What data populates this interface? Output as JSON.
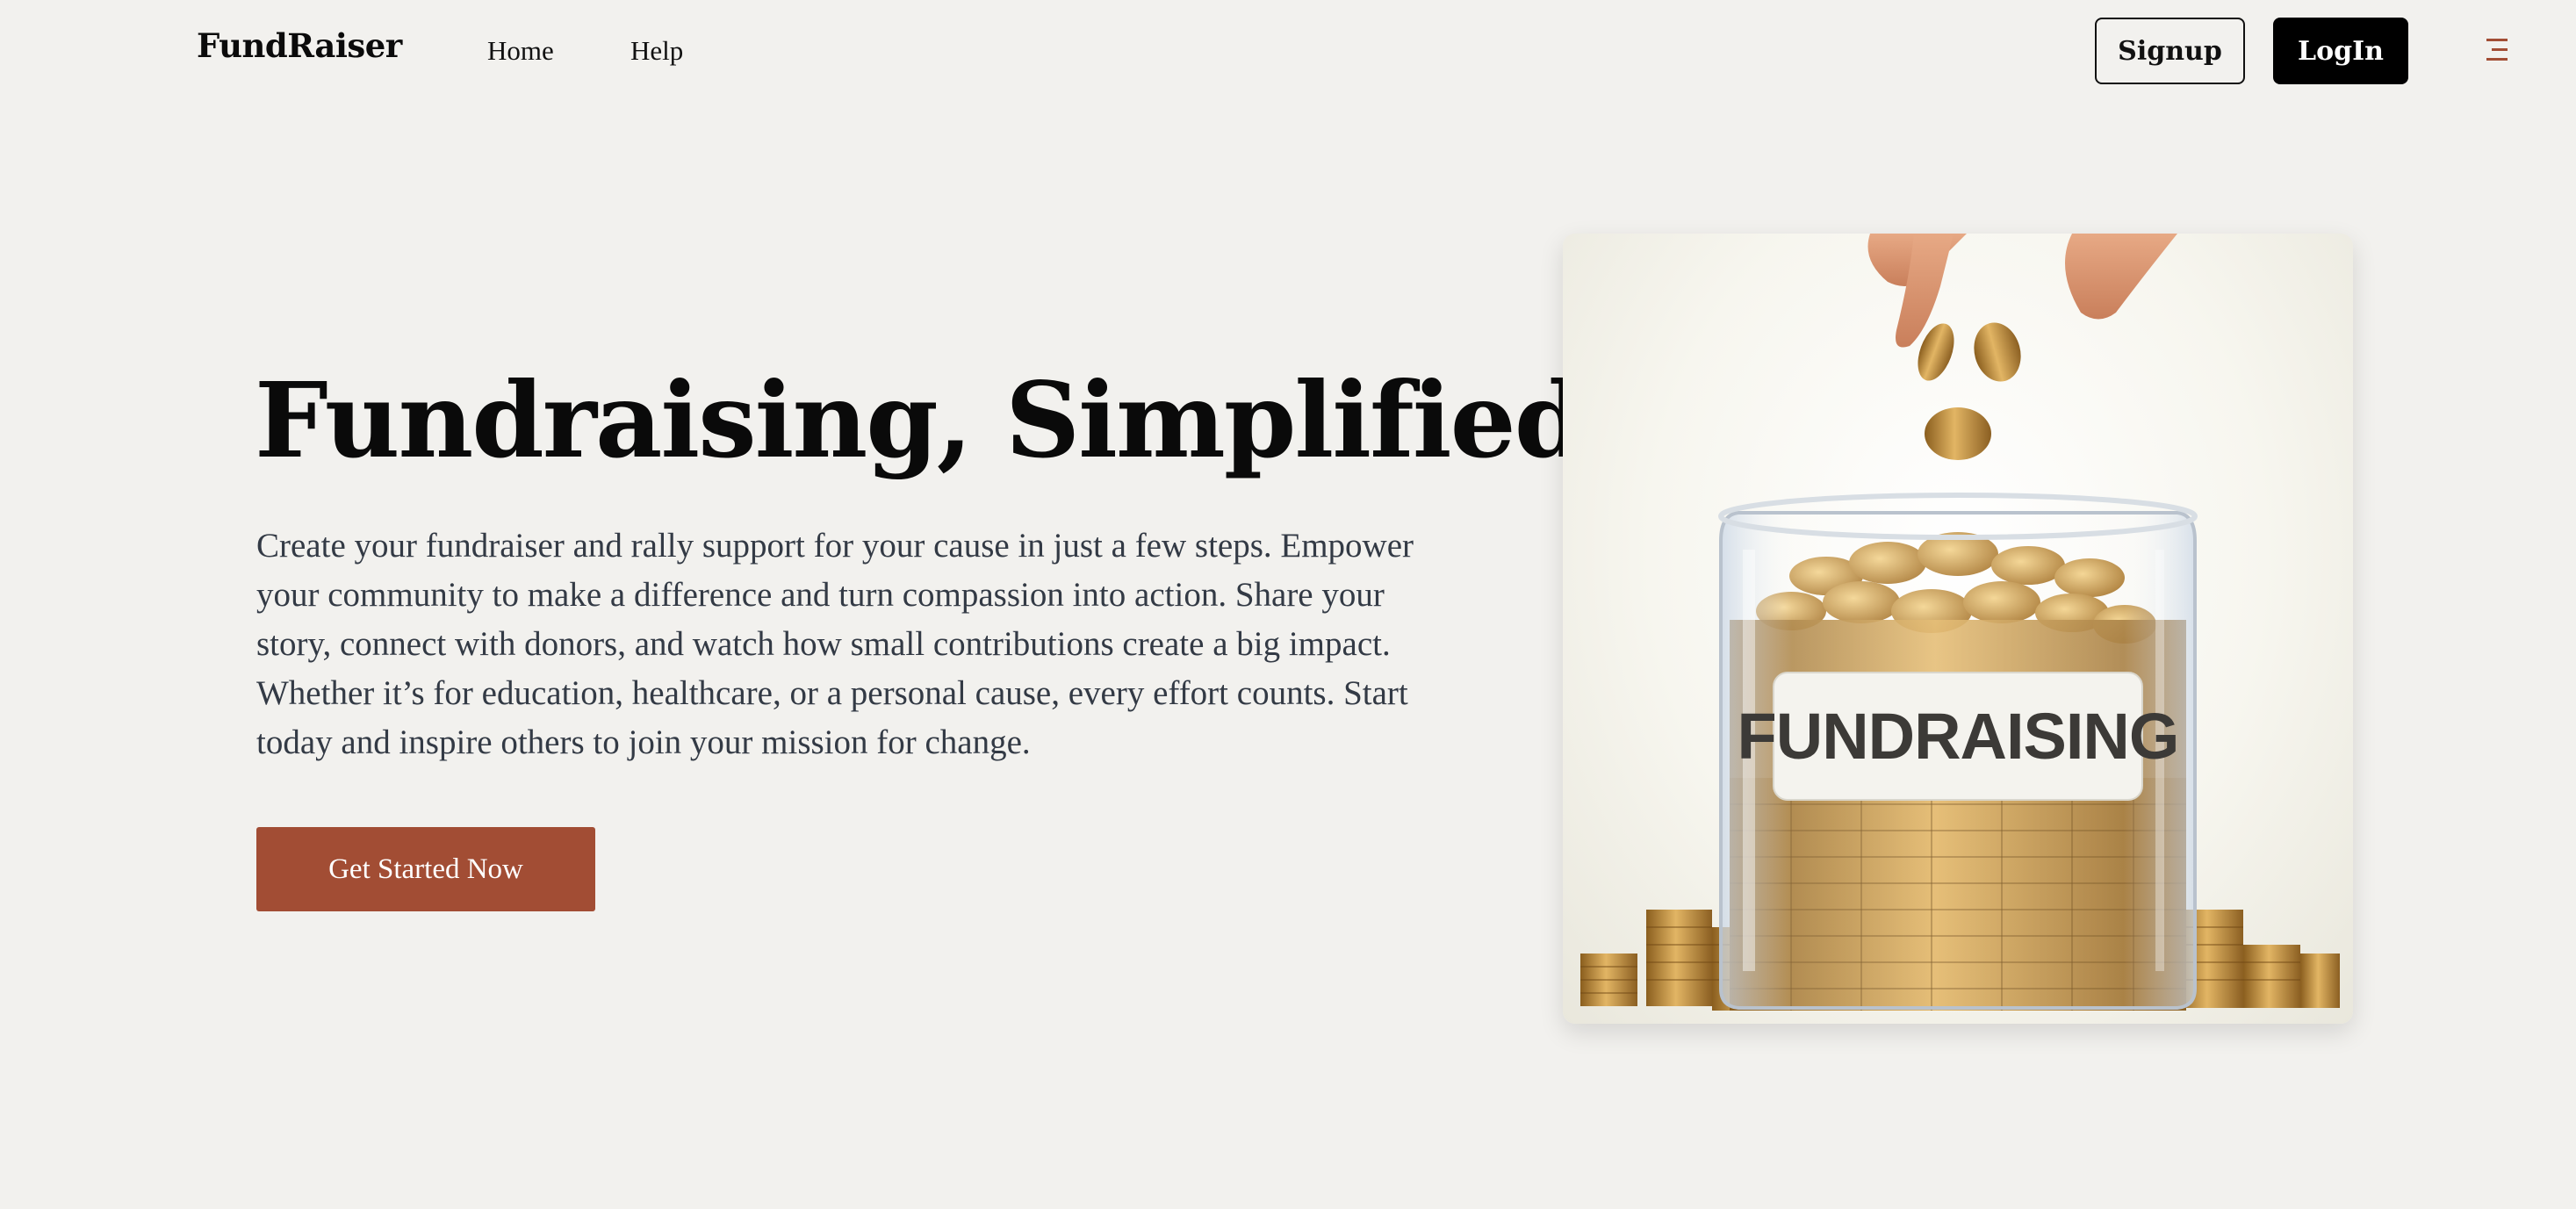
{
  "nav": {
    "brand": "FundRaiser",
    "links": [
      {
        "label": "Home"
      },
      {
        "label": "Help"
      }
    ],
    "signup_label": "Signup",
    "login_label": "LogIn",
    "menu_icon": "menu-icon"
  },
  "hero": {
    "title": "Fundraising, Simplified",
    "description": "Create your fundraiser and rally support for your cause in just a few steps. Empower your community to make a difference and turn compassion into action. Share your story, connect with donors, and watch how small contributions create a big impact. Whether it’s for education, healthcare, or a personal cause, every effort counts. Start today and inspire others to join your mission for change.",
    "cta_label": "Get Started Now",
    "image": {
      "jar_label": "FUNDRAISING"
    }
  },
  "colors": {
    "background": "#f2f1ee",
    "accent": "#a24d34",
    "primary_button": "#000000",
    "text": "#333a45"
  }
}
